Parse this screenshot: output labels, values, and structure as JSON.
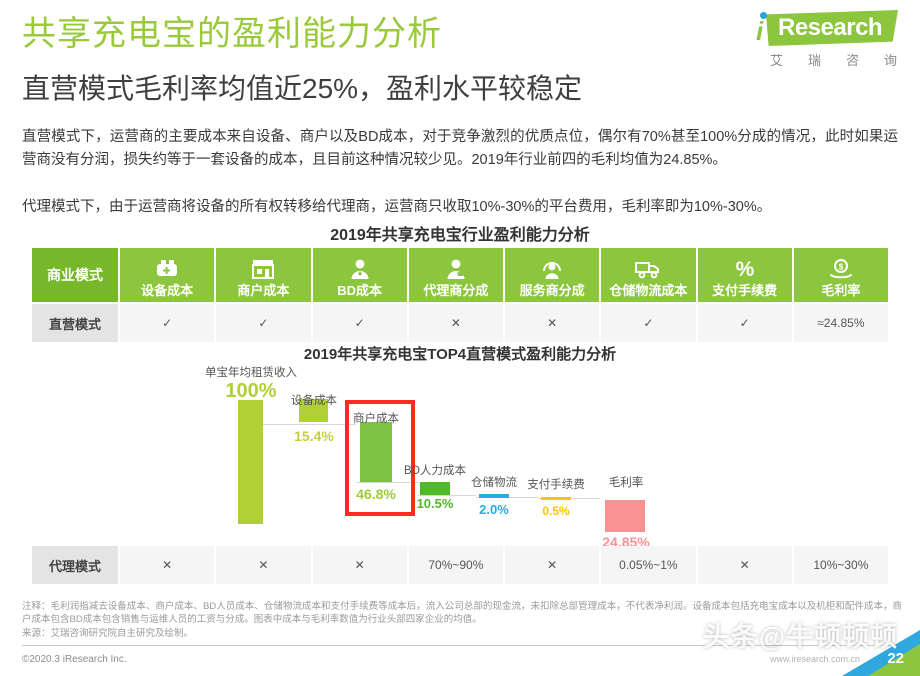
{
  "header": {
    "title": "共享充电宝的盈利能力分析",
    "subtitle": "直营模式毛利率均值近25%，盈利水平较稳定",
    "logo": {
      "i": "i",
      "word": "Research",
      "cn": [
        "艾",
        "瑞",
        "咨",
        "询"
      ]
    },
    "accent_green": "#8CC63F",
    "dark_green": "#77B82A"
  },
  "paragraphs": {
    "p1": "直营模式下，运营商的主要成本来自设备、商户以及BD成本，对于竞争激烈的优质点位，偶尔有70%甚至100%分成的情况，此时如果运营商没有分润，损失约等于一套设备的成本，且目前这种情况较少见。2019年行业前四的毛利均值为24.85%。",
    "p2": "代理模式下，由于运营商将设备的所有权转移给代理商，运营商只收取10%-30%的平台费用，毛利率即为10%-30%。"
  },
  "section_title": "2019年共享充电宝行业盈利能力分析",
  "table": {
    "headers": [
      {
        "label": "商业模式",
        "icon": ""
      },
      {
        "label": "设备成本",
        "icon": "charging-device-icon"
      },
      {
        "label": "商户成本",
        "icon": "shop-icon"
      },
      {
        "label": "BD成本",
        "icon": "person-tie-icon"
      },
      {
        "label": "代理商分成",
        "icon": "person-agent-icon"
      },
      {
        "label": "服务商分成",
        "icon": "person-service-icon"
      },
      {
        "label": "仓储物流成本",
        "icon": "truck-icon"
      },
      {
        "label": "支付手续费",
        "icon": "percent-icon"
      },
      {
        "label": "毛利率",
        "icon": "hand-money-icon"
      }
    ],
    "rows": [
      {
        "name": "直营模式",
        "cells": [
          "✓",
          "✓",
          "✓",
          "✕",
          "✕",
          "✓",
          "✓",
          "≈24.85%"
        ]
      },
      {
        "name": "代理模式",
        "cells": [
          "✕",
          "✕",
          "✕",
          "70%~90%",
          "✕",
          "0.05%~1%",
          "✕",
          "10%~30%"
        ]
      }
    ]
  },
  "chart_data": {
    "type": "bar",
    "title": "2019年共享充电宝TOP4直营模式盈利能力分析",
    "xlabel": "",
    "ylabel": "",
    "ylim": [
      0,
      100
    ],
    "grid": false,
    "legend": "none",
    "categories": [
      "单宝年均租赁收入",
      "设备成本",
      "商户成本",
      "BD人力成本",
      "仓储物流",
      "支付手续费",
      "毛利率"
    ],
    "values": [
      100,
      15.4,
      46.8,
      10.5,
      2.0,
      0.5,
      24.85
    ],
    "value_labels": [
      "100%",
      "15.4%",
      "46.8%",
      "10.5%",
      "2.0%",
      "0.5%",
      "24.85%"
    ],
    "colors": [
      "#AFD136",
      "#AFD136",
      "#7DC242",
      "#4FB82B",
      "#29ABE2",
      "#FFC20E",
      "#F79393"
    ],
    "highlighted_index": 2,
    "highlight_color": "#FF2A20"
  },
  "notes": {
    "note": "注释：毛利润指减去设备成本、商户成本、BD人员成本、仓储物流成本和支付手续费等成本后，流入公司总部的现金流，未扣除总部管理成本，不代表净利润。设备成本包括充电宝成本以及机柜和配件成本，商户成本包含BD成本包含销售与运维人员的工资与分成。图表中成本与毛利率数值为行业头部四家企业的均值。",
    "source": "来源：艾瑞咨询研究院自主研究及绘制。"
  },
  "footer": {
    "copyright": "©2020.3 iResearch Inc.",
    "site": "www.iresearch.com.cn",
    "page": "22"
  },
  "watermark": "头条@牛顿顿顿"
}
